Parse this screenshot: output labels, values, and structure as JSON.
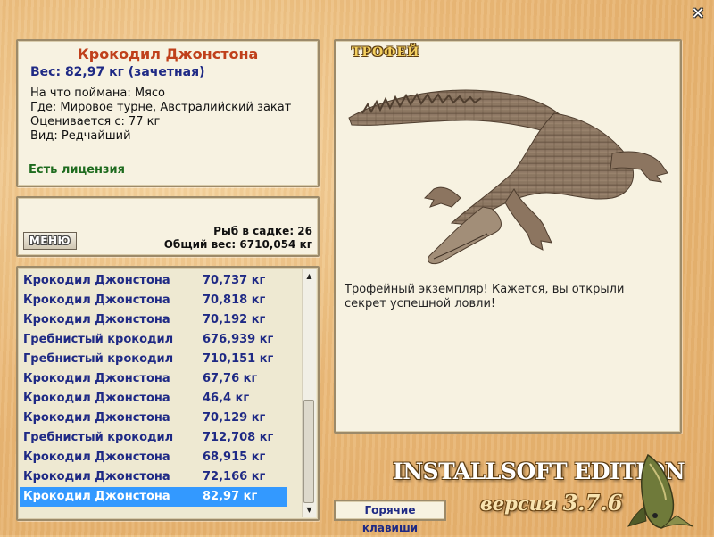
{
  "window": {
    "close_icon": "close-icon"
  },
  "info": {
    "title": "Крокодил Джонстона",
    "weight": "Вес: 82,97 кг (зачетная)",
    "bait": "На что поймана: Мясо",
    "location": "Где: Мировое турне, Австралийский закат",
    "value": "Оценивается с: 77 кг",
    "rarity": "Вид: Редчайший",
    "license": "Есть лицензия"
  },
  "stats": {
    "menu_label": "МЕНЮ",
    "fish_count": "Рыб в садке: 26",
    "total_weight": "Общий вес: 6710,054 кг"
  },
  "catch_list": [
    {
      "name": "Крокодил Джонстона",
      "weight": "70,737 кг"
    },
    {
      "name": "Крокодил Джонстона",
      "weight": "70,818 кг"
    },
    {
      "name": "Крокодил Джонстона",
      "weight": "70,192 кг"
    },
    {
      "name": "Гребнистый крокодил",
      "weight": "676,939 кг"
    },
    {
      "name": "Гребнистый крокодил",
      "weight": "710,151 кг"
    },
    {
      "name": "Крокодил Джонстона",
      "weight": "67,76 кг"
    },
    {
      "name": "Крокодил Джонстона",
      "weight": "46,4 кг"
    },
    {
      "name": "Крокодил Джонстона",
      "weight": "70,129 кг"
    },
    {
      "name": "Гребнистый крокодил",
      "weight": "712,708 кг"
    },
    {
      "name": "Крокодил Джонстона",
      "weight": "68,915 кг"
    },
    {
      "name": "Крокодил Джонстона",
      "weight": "72,166 кг"
    },
    {
      "name": "Крокодил Джонстона",
      "weight": "82,97 кг",
      "selected": true
    }
  ],
  "trophy": {
    "label": "ТРОФЕЙ",
    "text": "Трофейный экземпляр! Кажется, вы открыли секрет успешной ловли!"
  },
  "branding": {
    "edition": "INSTALLSOFT EDITION",
    "version_word": "версия",
    "version_number": "3.7.6"
  },
  "hotkeys_label": "Горячие клавиши",
  "colors": {
    "title_red": "#c0401b",
    "text_blue": "#1f2a85",
    "license_green": "#1e6b1e",
    "selection_blue": "#3399ff"
  }
}
